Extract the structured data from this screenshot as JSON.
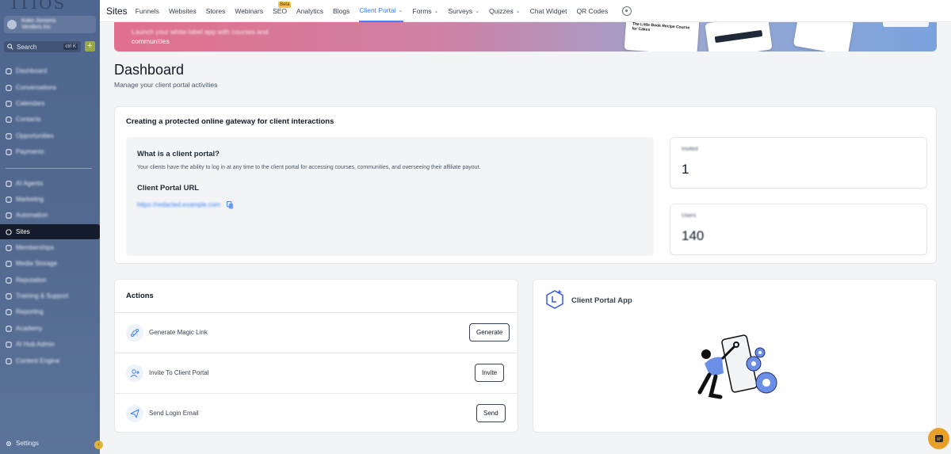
{
  "sidebar": {
    "account_name": "Koko Jonisms",
    "account_sub": "Vendors Inc",
    "search_placeholder": "Search",
    "search_shortcut": "ctrl K",
    "items": [
      {
        "label": "Dashboard",
        "icon": "dashboard-icon"
      },
      {
        "label": "Conversations",
        "icon": "chat-icon"
      },
      {
        "label": "Calendars",
        "icon": "calendar-icon"
      },
      {
        "label": "Contacts",
        "icon": "contacts-icon"
      },
      {
        "label": "Opportunities",
        "icon": "funnel-icon"
      },
      {
        "label": "Payments",
        "icon": "dollar-icon"
      },
      {
        "label": "AI Agents",
        "icon": "ai-icon"
      },
      {
        "label": "Marketing",
        "icon": "megaphone-icon"
      },
      {
        "label": "Automation",
        "icon": "automation-icon"
      },
      {
        "label": "Sites",
        "icon": "globe-icon"
      },
      {
        "label": "Memberships",
        "icon": "membership-icon"
      },
      {
        "label": "Media Storage",
        "icon": "media-icon"
      },
      {
        "label": "Reputation",
        "icon": "star-icon"
      },
      {
        "label": "Training & Support",
        "icon": "training-icon"
      },
      {
        "label": "Reporting",
        "icon": "chart-icon"
      },
      {
        "label": "Academy",
        "icon": "academy-icon"
      },
      {
        "label": "AI Hub Admin",
        "icon": "hub-icon"
      },
      {
        "label": "Content Engine",
        "icon": "engine-icon"
      }
    ],
    "settings_label": "Settings"
  },
  "topnav": {
    "section": "Sites",
    "items": [
      {
        "label": "Funnels",
        "dropdown": false
      },
      {
        "label": "Websites",
        "dropdown": false
      },
      {
        "label": "Stores",
        "dropdown": false
      },
      {
        "label": "Webinars",
        "dropdown": false
      },
      {
        "label": "SEO",
        "dropdown": false,
        "badge": "Beta"
      },
      {
        "label": "Analytics",
        "dropdown": false
      },
      {
        "label": "Blogs",
        "dropdown": false
      },
      {
        "label": "Client Portal",
        "dropdown": true,
        "active": true
      },
      {
        "label": "Forms",
        "dropdown": true
      },
      {
        "label": "Surveys",
        "dropdown": true
      },
      {
        "label": "Quizzes",
        "dropdown": true
      },
      {
        "label": "Chat Widget",
        "dropdown": false
      },
      {
        "label": "QR Codes",
        "dropdown": false
      }
    ]
  },
  "banner": {
    "line1": "Launch your white-label app with courses and",
    "line2": "communities",
    "mock_title": "The Little Book Recipe Course for Cakes"
  },
  "header": {
    "title": "Dashboard",
    "subtitle": "Manage your client portal activities"
  },
  "gateway": {
    "title": "Creating a protected online gateway for client interactions",
    "question": "What is a client portal?",
    "description": "Your clients have the ability to log in at any time to the client portal for accessing courses, communities, and overseeing their affiliate payout.",
    "url_label": "Client Portal URL",
    "url_value": "https://redacted.example.com"
  },
  "stats": [
    {
      "label": "Invited",
      "value": "1"
    },
    {
      "label": "Users",
      "value": "140"
    }
  ],
  "actions": {
    "title": "Actions",
    "rows": [
      {
        "label": "Generate Magic Link",
        "button": "Generate",
        "icon": "magic-link-icon"
      },
      {
        "label": "Invite To Client Portal",
        "button": "Invite",
        "icon": "invite-user-icon"
      },
      {
        "label": "Send Login Email",
        "button": "Send",
        "icon": "send-icon"
      }
    ]
  },
  "app": {
    "title": "Client Portal App"
  },
  "colors": {
    "accent": "#3b82f6",
    "sidebar": "#53698f",
    "active_nav": "#151c2c",
    "chat_bubble": "#e8a02a"
  }
}
